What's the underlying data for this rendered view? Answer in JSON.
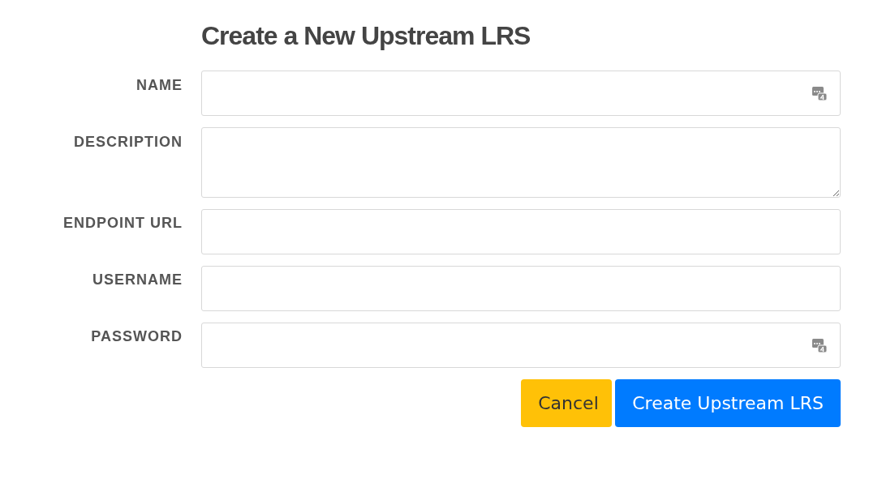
{
  "title": "Create a New Upstream LRS",
  "fields": [
    {
      "label": "NAME",
      "kind": "input",
      "autofill_icon": true
    },
    {
      "label": "DESCRIPTION",
      "kind": "textarea",
      "autofill_icon": false
    },
    {
      "label": "ENDPOINT URL",
      "kind": "input",
      "autofill_icon": false
    },
    {
      "label": "USERNAME",
      "kind": "input",
      "autofill_icon": false
    },
    {
      "label": "PASSWORD",
      "kind": "input",
      "autofill_icon": true
    }
  ],
  "buttons": [
    {
      "label": "Cancel",
      "kind": "warning"
    },
    {
      "label": "Create Upstream LRS",
      "kind": "primary"
    }
  ]
}
